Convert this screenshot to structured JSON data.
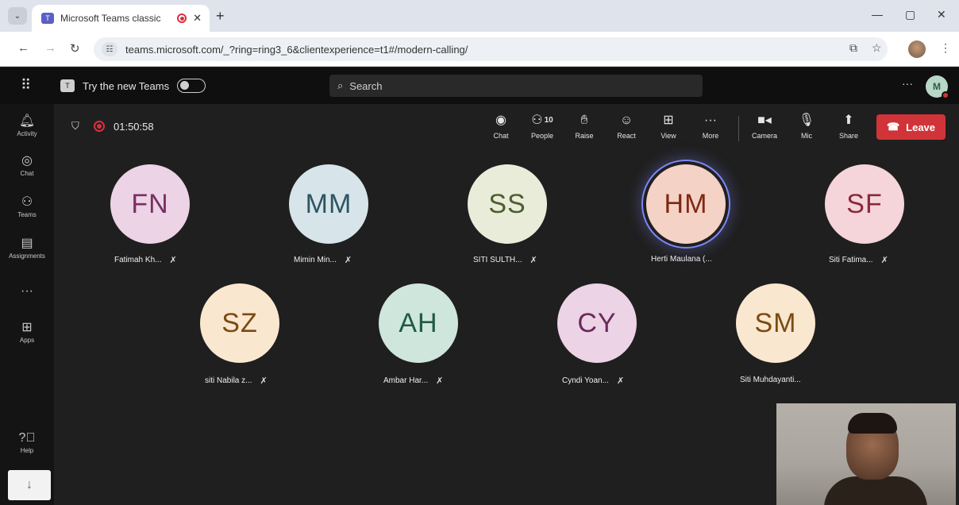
{
  "browser": {
    "tab_title": "Microsoft Teams classic",
    "tab_close": "✕",
    "new_tab": "+",
    "url": "teams.microsoft.com/_?ring=ring3_6&clientexperience=t1#/modern-calling/"
  },
  "teams": {
    "try_new_label": "Try the new Teams",
    "search_placeholder": "Search",
    "user_initials": "M"
  },
  "rail": [
    {
      "icon": "bell-icon",
      "label": "Activity"
    },
    {
      "icon": "chat-icon",
      "label": "Chat"
    },
    {
      "icon": "teams-icon",
      "label": "Teams"
    },
    {
      "icon": "assignments-icon",
      "label": "Assignments"
    },
    {
      "icon": "more-icon",
      "label": "···"
    },
    {
      "icon": "apps-icon",
      "label": "Apps"
    },
    {
      "icon": "help-icon",
      "label": "Help"
    }
  ],
  "meeting": {
    "timer": "01:50:58",
    "people_count": "10",
    "controls": [
      {
        "label": "Chat"
      },
      {
        "label": "People"
      },
      {
        "label": "Raise"
      },
      {
        "label": "React"
      },
      {
        "label": "View"
      },
      {
        "label": "More"
      },
      {
        "label": "Camera"
      },
      {
        "label": "Mic"
      },
      {
        "label": "Share"
      }
    ],
    "leave_label": "Leave"
  },
  "participants": [
    {
      "initials": "FN",
      "name": "Fatimah Kh...",
      "muted": true,
      "bg": "#ecd3e6",
      "fg": "#7a2f64"
    },
    {
      "initials": "MM",
      "name": "Mimin Min...",
      "muted": true,
      "bg": "#d7e5ea",
      "fg": "#2d5563"
    },
    {
      "initials": "SS",
      "name": "SITI SULTH...",
      "muted": true,
      "bg": "#e9ecd9",
      "fg": "#4c5d2f"
    },
    {
      "initials": "HM",
      "name": "Herti Maulana (...",
      "muted": false,
      "bg": "#f5d2c6",
      "fg": "#7c2a14",
      "speaking": true
    },
    {
      "initials": "SF",
      "name": "Siti Fatima...",
      "muted": true,
      "bg": "#f5d5da",
      "fg": "#8a2a3a"
    },
    {
      "initials": "SZ",
      "name": "siti Nabila z...",
      "muted": true,
      "bg": "#fae7cf",
      "fg": "#7a4b12"
    },
    {
      "initials": "AH",
      "name": "Ambar Har...",
      "muted": true,
      "bg": "#cfe6dd",
      "fg": "#1f5a45"
    },
    {
      "initials": "CY",
      "name": "Cyndi Yoan...",
      "muted": true,
      "bg": "#ecd3e6",
      "fg": "#6a2a5c"
    },
    {
      "initials": "SM",
      "name": "Siti Muhdayanti...",
      "muted": false,
      "bg": "#fae7cf",
      "fg": "#7a4b12"
    }
  ],
  "colors": {
    "leave": "#d13438",
    "speaking_ring": "#7f85f5",
    "recording": "#d9303c"
  }
}
